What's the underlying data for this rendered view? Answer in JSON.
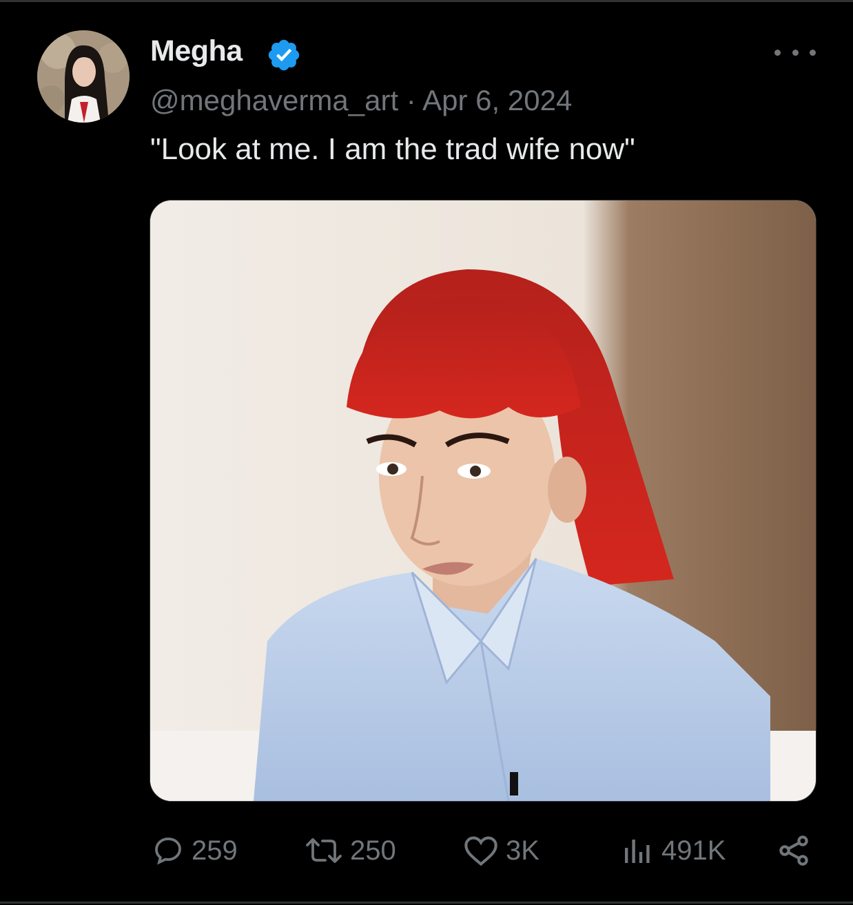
{
  "tweet": {
    "display_name": "Megha",
    "handle": "@meghaverma_art",
    "separator": "·",
    "date": "Apr 6, 2024",
    "text": "\"Look at me. I am the trad wife now\"",
    "verified": true,
    "verified_color": "#1d9bf0"
  },
  "actions": {
    "replies": "259",
    "reposts": "250",
    "likes": "3K",
    "views": "491K"
  },
  "icons": {
    "reply": "reply-icon",
    "repost": "repost-icon",
    "like": "heart-icon",
    "views": "views-chart-icon",
    "share": "share-icon",
    "more": "more-dots-icon"
  },
  "colors": {
    "background": "#000000",
    "text_primary": "#e7e9ea",
    "text_secondary": "#71767b",
    "border": "#2f3336"
  }
}
